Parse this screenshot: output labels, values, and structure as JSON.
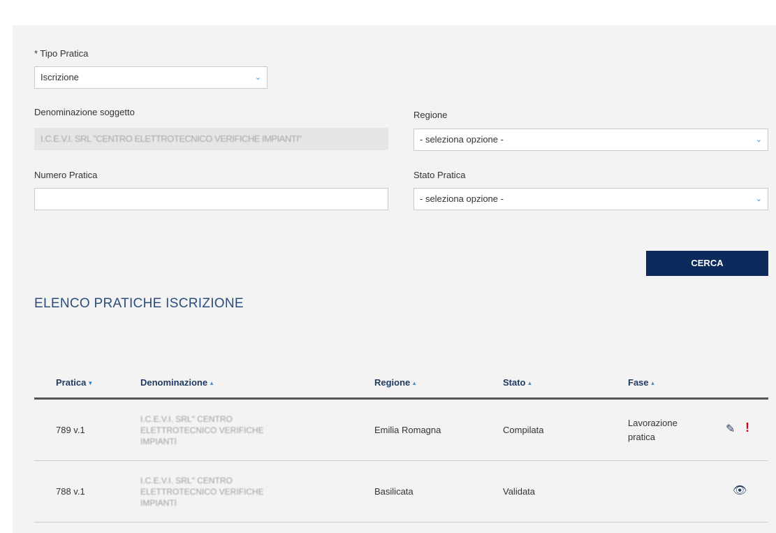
{
  "form": {
    "tipo_pratica": {
      "label": "* Tipo Pratica",
      "value": "Iscrizione"
    },
    "denominazione": {
      "label": "Denominazione soggetto",
      "value": "I.C.E.V.I. SRL \"CENTRO ELETTROTECNICO VERIFICHE IMPIANTI\""
    },
    "regione": {
      "label": "Regione",
      "value": "- seleziona opzione -"
    },
    "numero_pratica": {
      "label": "Numero Pratica",
      "value": ""
    },
    "stato_pratica": {
      "label": "Stato Pratica",
      "value": "- seleziona opzione -"
    },
    "cerca_label": "CERCA"
  },
  "section_title": "ELENCO PRATICHE ISCRIZIONE",
  "table": {
    "headers": {
      "pratica": "Pratica",
      "denominazione": "Denominazione",
      "regione": "Regione",
      "stato": "Stato",
      "fase": "Fase"
    },
    "rows": [
      {
        "pratica": "789 v.1",
        "denominazione": "I.C.E.V.I. SRL\" CENTRO ELETTROTECNICO VERIFICHE IMPIANTI",
        "regione": "Emilia Romagna",
        "stato": "Compilata",
        "fase": "Lavorazione pratica",
        "actions": [
          "pencil-icon",
          "alert-icon"
        ]
      },
      {
        "pratica": "788 v.1",
        "denominazione": "I.C.E.V.I. SRL\" CENTRO ELETTROTECNICO VERIFICHE IMPIANTI",
        "regione": "Basilicata",
        "stato": "Validata",
        "fase": "",
        "actions": [
          "eye-icon"
        ]
      }
    ]
  },
  "colors": {
    "primary_button": "#0d2a5c",
    "section_title": "#2c4d7a",
    "alert": "#d0021b",
    "panel_bg": "#f3f3f3"
  }
}
